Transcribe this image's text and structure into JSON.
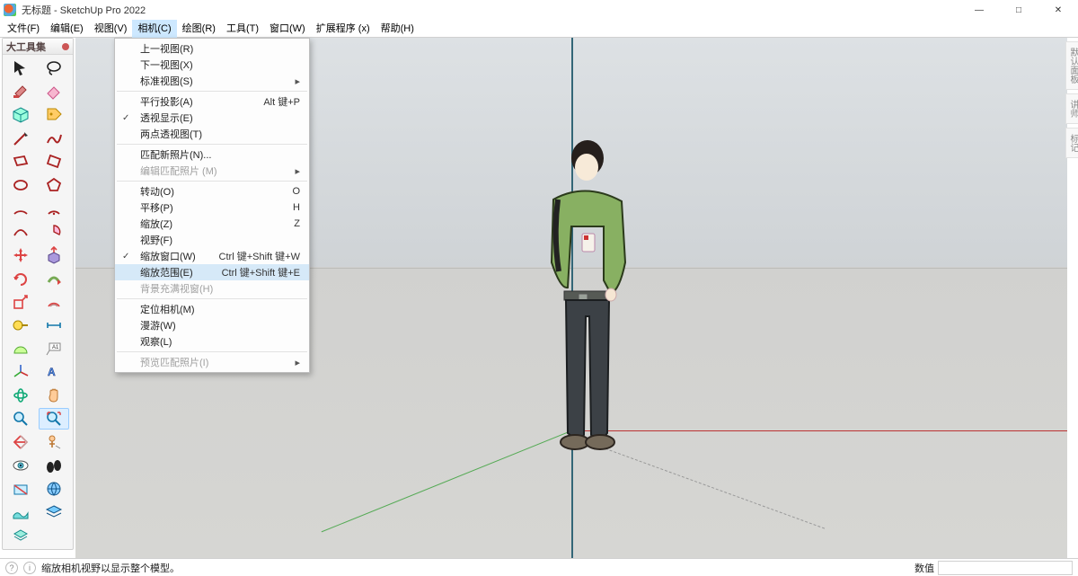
{
  "title": "无标题 - SketchUp Pro 2022",
  "menus": {
    "file": "文件(F)",
    "edit": "编辑(E)",
    "view": "视图(V)",
    "camera": "相机(C)",
    "draw": "绘图(R)",
    "tools": "工具(T)",
    "window": "窗口(W)",
    "ext": "扩展程序 (x)",
    "help": "帮助(H)"
  },
  "camera_menu": {
    "prev_view": "上一视图(R)",
    "next_view": "下一视图(X)",
    "std_views": "标准视图(S)",
    "parallel": "平行投影(A)",
    "parallel_k": "Alt 键+P",
    "perspective": "透视显示(E)",
    "two_point": "两点透视图(T)",
    "match_new": "匹配新照片(N)...",
    "match_edit": "编辑匹配照片 (M)",
    "orbit": "转动(O)",
    "orbit_k": "O",
    "pan": "平移(P)",
    "pan_k": "H",
    "zoom": "缩放(Z)",
    "zoom_k": "Z",
    "fov": "视野(F)",
    "zoom_win": "缩放窗口(W)",
    "zoom_win_k": "Ctrl 键+Shift 键+W",
    "zoom_ext": "缩放范围(E)",
    "zoom_ext_k": "Ctrl 键+Shift 键+E",
    "zoom_bg": "背景充满视窗(H)",
    "position": "定位相机(M)",
    "walk": "漫游(W)",
    "look": "观察(L)",
    "prev_photo": "预览匹配照片(I)"
  },
  "palette_title": "大工具集",
  "right_tabs": {
    "tray": "默认面板",
    "inst": "讲师",
    "tags": "标记"
  },
  "status": {
    "hint": "缩放相机视野以显示整个模型。",
    "value_label": "数值"
  }
}
